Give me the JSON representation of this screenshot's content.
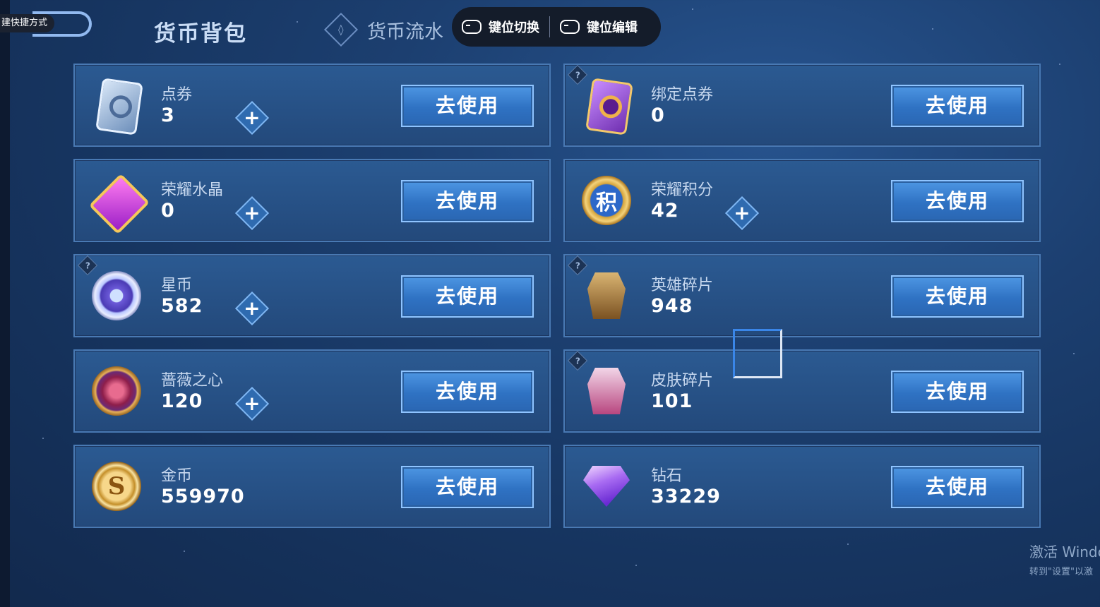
{
  "header": {
    "shortcut_label": "建快捷方式",
    "title": "货币背包",
    "flow_tab_label": "货币流水",
    "key_switch_label": "键位切换",
    "key_edit_label": "键位编辑"
  },
  "cards": [
    {
      "name": "点券",
      "value": "3",
      "action": "去使用",
      "icon": "voucher-icon",
      "plus": true,
      "help": false
    },
    {
      "name": "绑定点券",
      "value": "0",
      "action": "去使用",
      "icon": "bound-voucher-icon",
      "plus": false,
      "help": true
    },
    {
      "name": "荣耀水晶",
      "value": "0",
      "action": "去使用",
      "icon": "glory-crystal-icon",
      "plus": true,
      "help": false
    },
    {
      "name": "荣耀积分",
      "value": "42",
      "action": "去使用",
      "icon": "glory-points-icon",
      "plus": true,
      "help": false
    },
    {
      "name": "星币",
      "value": "582",
      "action": "去使用",
      "icon": "star-coin-icon",
      "plus": true,
      "help": true
    },
    {
      "name": "英雄碎片",
      "value": "948",
      "action": "去使用",
      "icon": "hero-fragment-icon",
      "plus": false,
      "help": true
    },
    {
      "name": "蔷薇之心",
      "value": "120",
      "action": "去使用",
      "icon": "rose-heart-icon",
      "plus": true,
      "help": false
    },
    {
      "name": "皮肤碎片",
      "value": "101",
      "action": "去使用",
      "icon": "skin-fragment-icon",
      "plus": false,
      "help": true
    },
    {
      "name": "金币",
      "value": "559970",
      "action": "去使用",
      "icon": "gold-coin-icon",
      "plus": false,
      "help": false
    },
    {
      "name": "钻石",
      "value": "33229",
      "action": "去使用",
      "icon": "diamond-icon",
      "plus": false,
      "help": false
    }
  ],
  "icon_glyphs": {
    "glory_points": "积",
    "gold_coin": "S",
    "help": "?",
    "plus": "+",
    "flow_tab": "◊"
  },
  "watermark": {
    "line1": "激活 Windo",
    "line2": "转到\"设置\"以激"
  },
  "colors": {
    "accent_button": "#2f72c3",
    "card_border": "#4979b3",
    "background": "#1c3f70"
  }
}
